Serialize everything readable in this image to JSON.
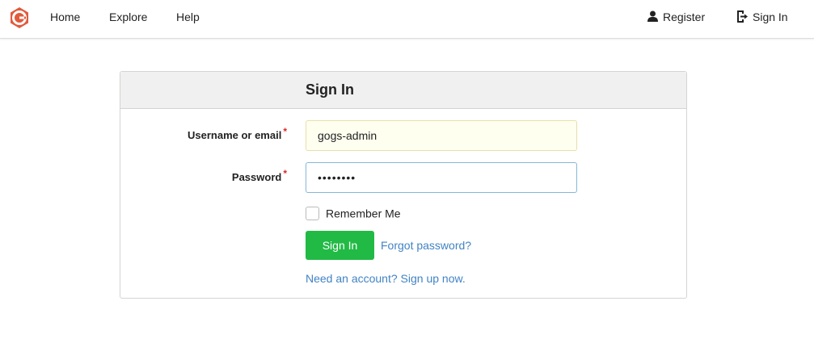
{
  "nav": {
    "home": "Home",
    "explore": "Explore",
    "help": "Help",
    "register": "Register",
    "signin": "Sign In"
  },
  "icons": {
    "logo": "gogs-logo",
    "register": "user-icon",
    "signin": "sign-in-icon"
  },
  "colors": {
    "brand": "#e25a3c",
    "primary_button": "#21ba45",
    "link": "#4183c4",
    "required": "#db2828"
  },
  "form": {
    "title": "Sign In",
    "username_label": "Username or email",
    "username_value": "gogs-admin",
    "password_label": "Password",
    "password_value": "••••••••",
    "required_mark": "*",
    "remember_label": "Remember Me",
    "remember_checked": false,
    "submit_label": "Sign In",
    "forgot_link": "Forgot password?",
    "signup_link": "Need an account? Sign up now."
  }
}
